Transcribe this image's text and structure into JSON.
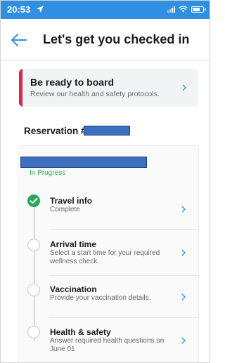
{
  "status_bar": {
    "time": "20:53"
  },
  "header": {
    "title": "Let's get you checked in"
  },
  "board_card": {
    "title": "Be ready to board",
    "subtitle": "Review our health and safety protocols."
  },
  "reservation": {
    "label": "Reservation #"
  },
  "booking": {
    "status": "In Progress"
  },
  "steps": [
    {
      "title": "Travel info",
      "desc": "Complete",
      "state": "done"
    },
    {
      "title": "Arrival time",
      "desc": "Select a start time for your required wellness check.",
      "state": "todo"
    },
    {
      "title": "Vaccination",
      "desc": "Provide your vaccination details.",
      "state": "todo"
    },
    {
      "title": "Health & safety",
      "desc": "Answer required health questions on June 01",
      "state": "todo"
    }
  ],
  "colors": {
    "status_bar": "#2f8fe3",
    "accent_red": "#d7264f",
    "success_green": "#27a85a",
    "link_blue": "#2f8fe3"
  }
}
